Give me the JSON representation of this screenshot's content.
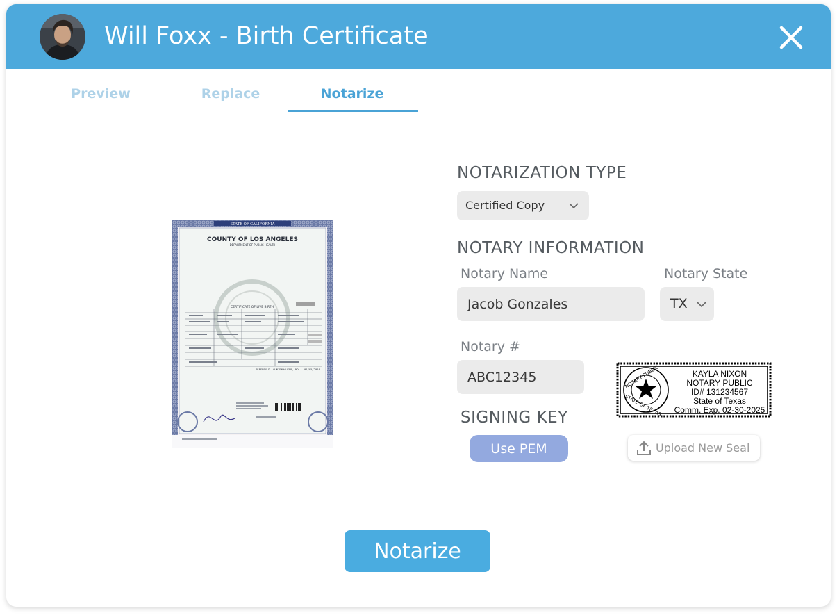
{
  "header": {
    "title": "Will Foxx - Birth Certificate",
    "bg_color": "#4da9dc",
    "avatar_icon": "user-avatar",
    "close_icon": "close-icon"
  },
  "tabs": [
    {
      "label": "Preview",
      "active": false
    },
    {
      "label": "Replace",
      "active": false
    },
    {
      "label": "Notarize",
      "active": true
    }
  ],
  "document": {
    "state_banner": "STATE OF CALIFORNIA",
    "county": "COUNTY OF LOS ANGELES",
    "department": "DEPARTMENT OF PUBLIC HEALTH",
    "certificate_title": "CERTIFICATE OF LIVE BIRTH",
    "registrar_line": "JEFFREY D. GUNZENHAUSER, MD",
    "date": "01/05/2010"
  },
  "notarization": {
    "type_heading": "NOTARIZATION TYPE",
    "type_value": "Certified Copy"
  },
  "notary_info": {
    "heading": "NOTARY INFORMATION",
    "name_label": "Notary Name",
    "name_value": "Jacob Gonzales",
    "state_label": "Notary State",
    "state_value": "TX",
    "number_label": "Notary #",
    "number_value": "ABC12345"
  },
  "signing_key": {
    "heading": "SIGNING KEY",
    "button_label": "Use PEM"
  },
  "seal": {
    "name": "KAYLA NIXON",
    "title": "NOTARY PUBLIC",
    "id": "ID# 131234567",
    "state": "State of Texas",
    "expiry": "Comm. Exp. 02-30-2025",
    "ring_top": "NOTARY PUBLIC",
    "ring_bottom": "STATE OF TEXAS"
  },
  "upload": {
    "label": "Upload New Seal",
    "icon": "upload-icon"
  },
  "primary_action": {
    "label": "Notarize",
    "color": "#4aace0"
  }
}
